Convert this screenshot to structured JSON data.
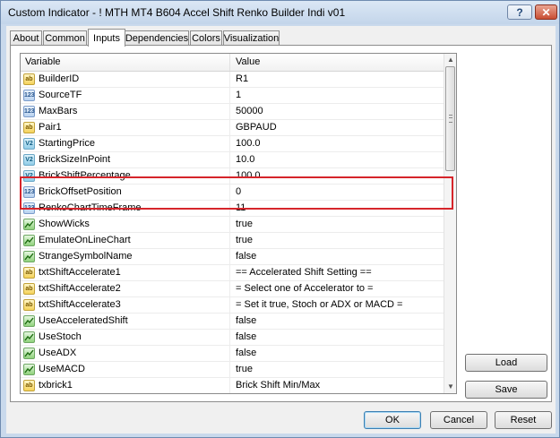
{
  "window": {
    "title": "Custom Indicator - !  MTH MT4 B604 Accel Shift Renko Builder Indi v01",
    "help_label": "?",
    "close_label": "✕"
  },
  "tabs": [
    {
      "label": "About"
    },
    {
      "label": "Common"
    },
    {
      "label": "Inputs"
    },
    {
      "label": "Dependencies"
    },
    {
      "label": "Colors"
    },
    {
      "label": "Visualization"
    }
  ],
  "active_tab": "Inputs",
  "grid": {
    "header": {
      "variable": "Variable",
      "value": "Value"
    },
    "rows": [
      {
        "icon": "ab",
        "name": "BuilderID",
        "value": "R1"
      },
      {
        "icon": "123",
        "name": "SourceTF",
        "value": "1"
      },
      {
        "icon": "123",
        "name": "MaxBars",
        "value": "50000"
      },
      {
        "icon": "ab",
        "name": "Pair1",
        "value": "GBPAUD"
      },
      {
        "icon": "v2",
        "name": "StartingPrice",
        "value": "100.0"
      },
      {
        "icon": "v2",
        "name": "BrickSizeInPoint",
        "value": "10.0"
      },
      {
        "icon": "v2",
        "name": "BrickShiftPercentage",
        "value": "100.0"
      },
      {
        "icon": "123",
        "name": "BrickOffsetPosition",
        "value": "0"
      },
      {
        "icon": "123",
        "name": "RenkoChartTimeFrame",
        "value": "11"
      },
      {
        "icon": "bool",
        "name": "ShowWicks",
        "value": "true"
      },
      {
        "icon": "bool",
        "name": "EmulateOnLineChart",
        "value": "true"
      },
      {
        "icon": "bool",
        "name": "StrangeSymbolName",
        "value": "false"
      },
      {
        "icon": "ab",
        "name": "txtShiftAccelerate1",
        "value": "== Accelerated Shift Setting  =="
      },
      {
        "icon": "ab",
        "name": "txtShiftAccelerate2",
        "value": "= Select one of Accelerator to ="
      },
      {
        "icon": "ab",
        "name": "txtShiftAccelerate3",
        "value": "= Set it true, Stoch or ADX or MACD ="
      },
      {
        "icon": "bool",
        "name": "UseAcceleratedShift",
        "value": "false"
      },
      {
        "icon": "bool",
        "name": "UseStoch",
        "value": "false"
      },
      {
        "icon": "bool",
        "name": "UseADX",
        "value": "false"
      },
      {
        "icon": "bool",
        "name": "UseMACD",
        "value": "true"
      },
      {
        "icon": "ab",
        "name": "txbrick1",
        "value": "Brick Shift Min/Max"
      }
    ],
    "icon_labels": {
      "ab": "ab",
      "123": "123",
      "v2": "V2",
      "bool": ""
    }
  },
  "buttons": {
    "load": "Load",
    "save": "Save",
    "ok": "OK",
    "cancel": "Cancel",
    "reset": "Reset"
  },
  "colors": {
    "highlight_border": "#d6252b"
  }
}
